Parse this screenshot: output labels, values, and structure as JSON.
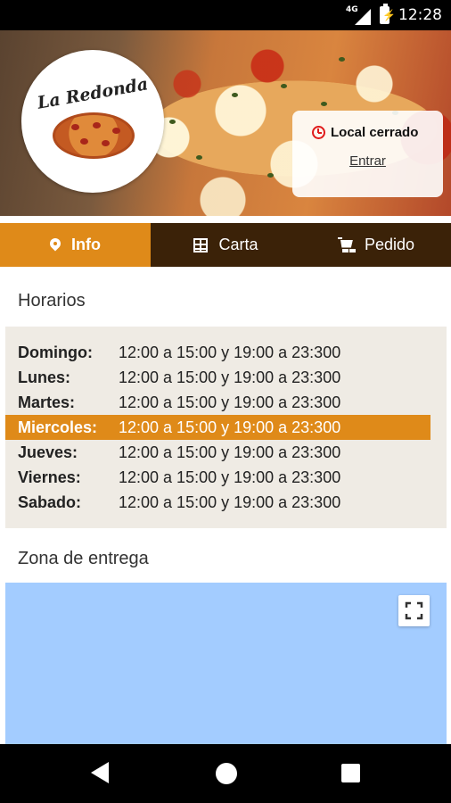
{
  "status_bar": {
    "network": "4G",
    "time": "12:28"
  },
  "header": {
    "restaurant_name": "La Redonda",
    "status_text": "Local cerrado",
    "enter_link": "Entrar"
  },
  "tabs": [
    {
      "label": "Info",
      "icon": "location-pin-icon",
      "active": true
    },
    {
      "label": "Carta",
      "icon": "menu-grid-icon",
      "active": false
    },
    {
      "label": "Pedido",
      "icon": "shopping-cart-icon",
      "active": false
    }
  ],
  "hours": {
    "title": "Horarios",
    "rows": [
      {
        "day": "Domingo:",
        "time": "12:00 a 15:00 y 19:00 a 23:300"
      },
      {
        "day": "Lunes:",
        "time": "12:00 a 15:00 y 19:00 a 23:300"
      },
      {
        "day": "Martes:",
        "time": "12:00 a 15:00 y 19:00 a 23:300"
      },
      {
        "day": "Miercoles:",
        "time": "12:00 a 15:00 y 19:00 a 23:300"
      },
      {
        "day": "Jueves:",
        "time": "12:00 a 15:00 y 19:00 a 23:300"
      },
      {
        "day": "Viernes:",
        "time": "12:00 a 15:00 y 19:00 a 23:300"
      },
      {
        "day": "Sabado:",
        "time": "12:00 a 15:00 y 19:00 a 23:300"
      }
    ],
    "highlighted_day": "Miercoles:"
  },
  "delivery": {
    "title": "Zona de entrega"
  },
  "colors": {
    "accent": "#df8a19",
    "tab_bar": "#3b2208",
    "map_water": "#a3ccff",
    "closed_red": "#e01b1b"
  }
}
